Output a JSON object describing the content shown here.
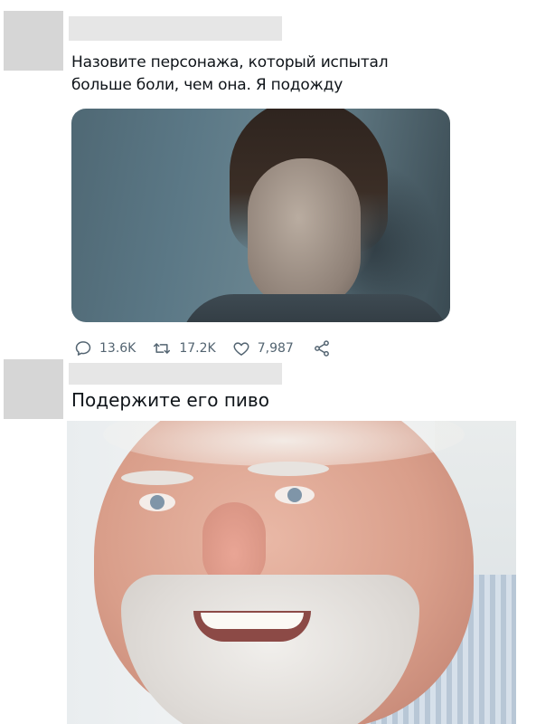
{
  "tweet": {
    "text_line1": "Назовите персонажа, который испытал",
    "text_line2": "больше боли, чем она. Я подожду",
    "media_description": "",
    "stats": {
      "replies": "13.6K",
      "retweets": "17.2K",
      "likes": "7,987"
    }
  },
  "reply": {
    "text": "Подержите его пиво"
  },
  "colors": {
    "avatar_placeholder": "#d6d6d6",
    "name_placeholder": "#e6e6e6",
    "icon_gray": "#536471",
    "text": "#0f1419"
  },
  "icons": [
    "reply-icon",
    "retweet-icon",
    "like-icon",
    "share-icon"
  ]
}
